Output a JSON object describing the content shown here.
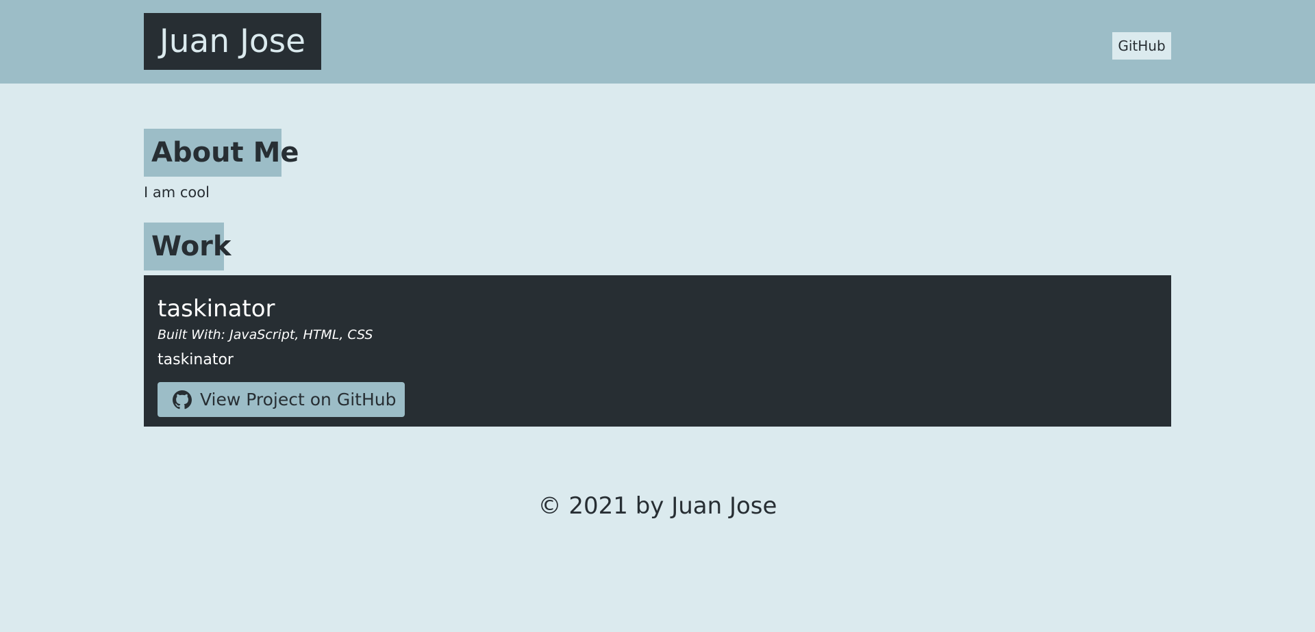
{
  "header": {
    "brand": "Juan Jose",
    "nav": [
      {
        "label": "GitHub"
      }
    ]
  },
  "about": {
    "heading": "About Me",
    "text": "I am cool"
  },
  "work": {
    "heading": "Work",
    "projects": [
      {
        "title": "taskinator",
        "built_with": "Built With: JavaScript, HTML, CSS",
        "description": "taskinator",
        "button_label": "View Project on GitHub",
        "button_icon": "github-icon"
      }
    ]
  },
  "footer": {
    "text": "© 2021 by Juan Jose"
  },
  "colors": {
    "header_bg": "#9cbdc7",
    "page_bg": "#dbeaee",
    "dark": "#272e33"
  }
}
